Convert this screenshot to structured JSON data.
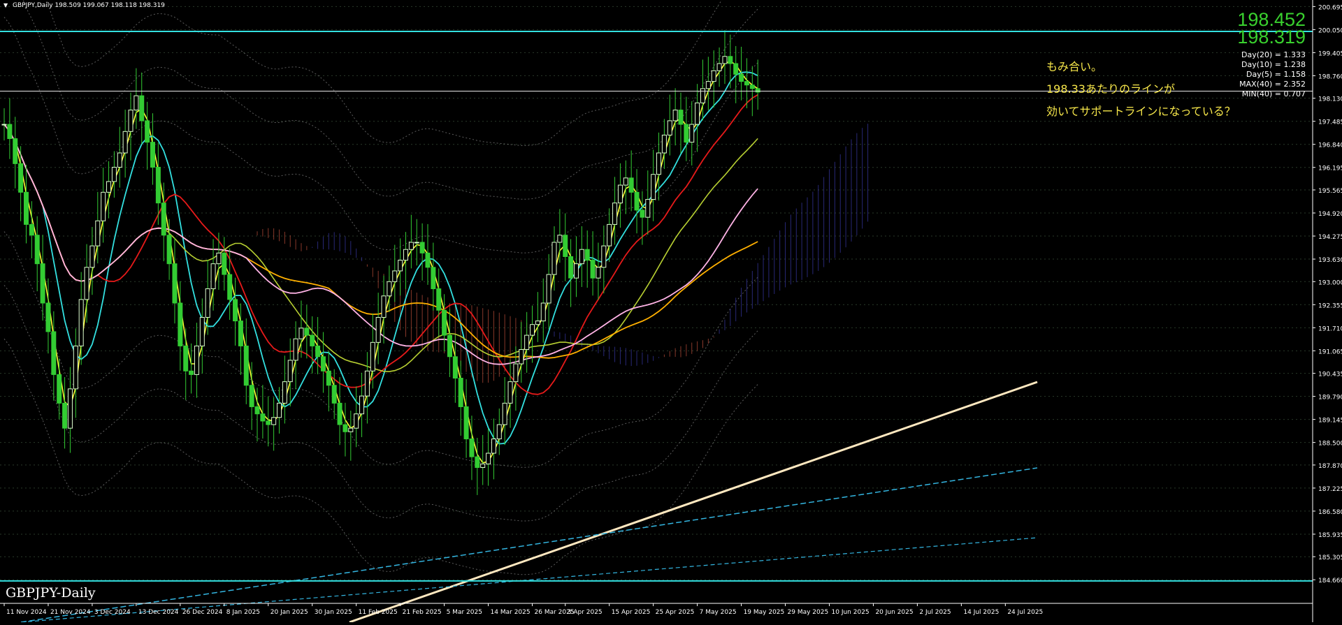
{
  "header": {
    "symbol_line": "GBPJPY,Daily  198.509 199.067 198.118 198.319",
    "arrow": "▼"
  },
  "watermark": "GBPJPY-Daily",
  "prices": {
    "last_big": "198.452",
    "bid_big": "198.319"
  },
  "stats": [
    "Day(20) = 1.333",
    "Day(10) = 1.238",
    "Day(5) = 1.158",
    "MAX(40) = 2.352",
    "MIN(40) = 0.707"
  ],
  "annotations": [
    "もみ合い。",
    "198.33あたりのラインが",
    "効いてサポートラインになっている？"
  ],
  "colors": {
    "background": "#000000",
    "candle": "#33cc33",
    "ma_fast": "#ffff33",
    "ma_mid": "#33e0e0",
    "ma_red": "#e61a1a",
    "ma_yellowgreen": "#b8d032",
    "ma_orange": "#ffb000",
    "ma_pink": "#ffb3e6",
    "trend_white": "#ffe8c0",
    "cloud_blue": "#3a3aa8",
    "cloud_red": "#c0503c",
    "hline_cyan": "#33e0e0",
    "annotation": "#f6e64a",
    "price_big": "#39d02e"
  },
  "chart_data": {
    "type": "candlestick",
    "title": "",
    "xlabel": "",
    "ylabel": "",
    "ylim": [
      184.0,
      200.8
    ],
    "y_ticks": [
      "200.695",
      "200.050",
      "199.405",
      "198.760",
      "198.130",
      "197.485",
      "196.840",
      "196.195",
      "195.565",
      "194.920",
      "194.275",
      "193.630",
      "193.000",
      "192.355",
      "191.710",
      "191.065",
      "190.435",
      "189.790",
      "189.145",
      "188.500",
      "187.870",
      "187.225",
      "186.580",
      "185.935",
      "185.305",
      "184.660"
    ],
    "x_ticks": [
      "11 Nov 2024",
      "21 Nov 2024",
      "3 Dec 2024",
      "13 Dec 2024",
      "26 Dec 2024",
      "8 Jan 2025",
      "20 Jan 2025",
      "30 Jan 2025",
      "11 Feb 2025",
      "21 Feb 2025",
      "5 Mar 2025",
      "14 Mar 2025",
      "26 Mar 2025",
      "3 Apr 2025",
      "15 Apr 2025",
      "25 Apr 2025",
      "7 May 2025",
      "19 May 2025",
      "29 May 2025",
      "10 Jun 2025",
      "20 Jun 2025",
      "2 Jul 2025",
      "14 Jul 2025",
      "24 Jul 2025"
    ],
    "x_tick_index": [
      0,
      8,
      16,
      24,
      32,
      40,
      48,
      56,
      64,
      72,
      80,
      88,
      96,
      102,
      110,
      118,
      126,
      134,
      142,
      150,
      158,
      166,
      174,
      182
    ],
    "closes": [
      197.4,
      197.0,
      196.3,
      195.5,
      194.6,
      194.3,
      193.5,
      192.4,
      191.6,
      190.4,
      189.6,
      188.9,
      190.0,
      191.2,
      192.5,
      193.4,
      194.0,
      194.7,
      195.5,
      195.8,
      196.2,
      196.6,
      197.2,
      197.8,
      198.2,
      197.5,
      196.9,
      196.2,
      195.2,
      194.3,
      193.5,
      192.4,
      191.2,
      190.5,
      190.4,
      191.2,
      192.0,
      192.8,
      193.5,
      193.8,
      193.2,
      192.5,
      191.9,
      191.2,
      190.1,
      189.5,
      189.3,
      189.1,
      189.0,
      189.2,
      189.6,
      190.2,
      190.8,
      191.4,
      191.7,
      191.5,
      191.2,
      190.9,
      190.5,
      190.1,
      189.6,
      189.0,
      188.8,
      188.9,
      189.3,
      189.8,
      190.5,
      191.3,
      192.0,
      192.6,
      193.0,
      193.3,
      193.6,
      193.9,
      194.1,
      194.1,
      193.8,
      193.4,
      192.8,
      192.2,
      191.5,
      190.9,
      190.3,
      189.5,
      188.6,
      188.1,
      187.8,
      187.9,
      188.2,
      188.6,
      189.0,
      189.6,
      190.2,
      190.7,
      191.1,
      191.5,
      191.8,
      191.9,
      192.4,
      193.2,
      194.1,
      194.3,
      193.7,
      193.1,
      193.5,
      193.9,
      193.6,
      193.1,
      193.4,
      194.0,
      194.6,
      195.2,
      195.7,
      195.9,
      195.5,
      195.0,
      194.8,
      195.3,
      196.0,
      196.6,
      197.1,
      197.5,
      197.8,
      197.4,
      196.9,
      197.4,
      198.0,
      198.4,
      198.6,
      198.9,
      199.1,
      199.3,
      199.1,
      198.8,
      198.6,
      198.5,
      198.4,
      198.3
    ]
  }
}
